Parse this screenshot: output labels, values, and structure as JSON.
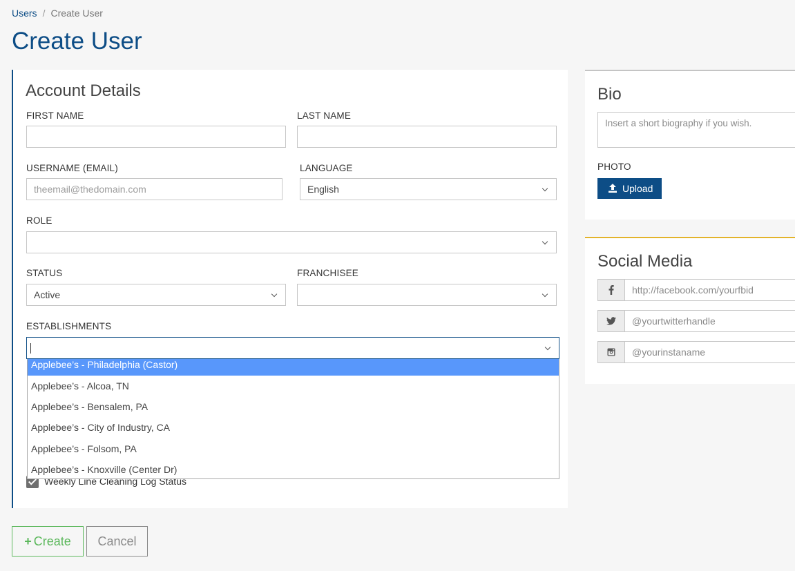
{
  "breadcrumb": {
    "parent": "Users",
    "separator": "/",
    "current": "Create User"
  },
  "page_title": "Create User",
  "account": {
    "title": "Account Details",
    "first_name": {
      "label": "FIRST NAME",
      "value": ""
    },
    "last_name": {
      "label": "LAST NAME",
      "value": ""
    },
    "username": {
      "label": "USERNAME (EMAIL)",
      "placeholder": "theemail@thedomain.com"
    },
    "language": {
      "label": "LANGUAGE",
      "value": "English"
    },
    "role": {
      "label": "ROLE",
      "value": ""
    },
    "status": {
      "label": "STATUS",
      "value": "Active"
    },
    "franchisee": {
      "label": "FRANCHISEE",
      "value": ""
    },
    "establishments": {
      "label": "ESTABLISHMENTS",
      "options": [
        "Applebee’s - Philadelphia (Castor)",
        "Applebee’s - Alcoa, TN",
        "Applebee’s - Bensalem, PA",
        "Applebee’s - City of Industry, CA",
        "Applebee’s - Folsom, PA",
        "Applebee’s - Knoxville (Center Dr)"
      ],
      "highlighted_index": 0
    },
    "checkbox_label": "Weekly Line Cleaning Log Status"
  },
  "bio": {
    "title": "Bio",
    "placeholder": "Insert a short biography if you wish.",
    "photo_label": "PHOTO",
    "upload_label": "Upload"
  },
  "social": {
    "title": "Social Media",
    "facebook_placeholder": "http://facebook.com/yourfbid",
    "twitter_placeholder": "@yourtwitterhandle",
    "instagram_placeholder": "@yourinstaname"
  },
  "actions": {
    "create_label": "Create",
    "cancel_label": "Cancel"
  },
  "colors": {
    "primary": "#0d4d86",
    "success": "#5cb85c",
    "highlight": "#5897fb",
    "social_accent": "#e3b32b"
  }
}
